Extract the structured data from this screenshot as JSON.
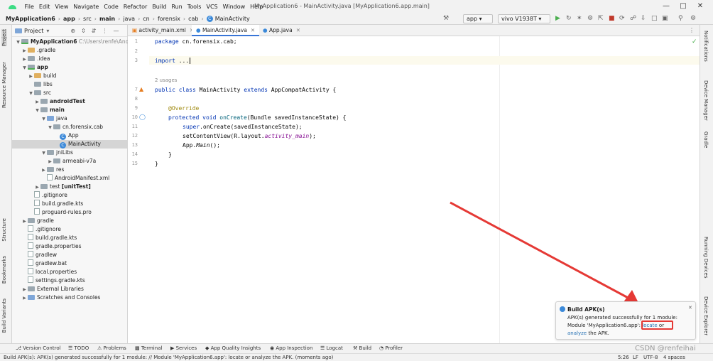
{
  "menu": [
    "File",
    "Edit",
    "View",
    "Navigate",
    "Code",
    "Refactor",
    "Build",
    "Run",
    "Tools",
    "VCS",
    "Window",
    "Help"
  ],
  "window_title": "MyApplication6 - MainActivity.java [MyApplication6.app.main]",
  "breadcrumbs": [
    "MyApplication6",
    "app",
    "src",
    "main",
    "java",
    "cn",
    "forensix",
    "cab",
    "MainActivity"
  ],
  "toolbar": {
    "run_config": "app",
    "device": "vivo V1938T"
  },
  "project_panel": {
    "header": "Project",
    "root": "MyApplication6",
    "root_path": "C:\\Users\\renfe\\Andro",
    "tree": [
      ".gradle",
      ".idea",
      "app",
      "build",
      "libs",
      "src",
      "androidTest",
      "main",
      "java",
      "cn.forensix.cab",
      "App",
      "MainActivity",
      "jniLibs",
      "armeabi-v7a",
      "res",
      "AndroidManifest.xml",
      "test",
      "[unitTest]",
      ".gitignore",
      "build.gradle.kts",
      "proguard-rules.pro",
      "gradle",
      ".gitignore",
      "build.gradle.kts",
      "gradle.properties",
      "gradlew",
      "gradlew.bat",
      "local.properties",
      "settings.gradle.kts",
      "External Libraries",
      "Scratches and Consoles"
    ]
  },
  "tabs": [
    {
      "label": "activity_main.xml"
    },
    {
      "label": "MainActivity.java"
    },
    {
      "label": "App.java"
    }
  ],
  "editor": {
    "line_numbers": [
      "1",
      "2",
      "3",
      "",
      "7",
      "8",
      "9",
      "10",
      "11",
      "12",
      "13",
      "14",
      "15"
    ],
    "usages": "2 usages",
    "code": {
      "package_kw": "package",
      "package_name": " cn.forensix.cab;",
      "import_kw": "import",
      "import_rest": " ...",
      "class_public": "public",
      "class_class": " class",
      "class_name": " MainActivity ",
      "class_extends": "extends",
      "class_rest": " AppCompatActivity {",
      "override": "@Override",
      "method_kw": "protected void",
      "method_name": " onCreate",
      "method_rest": "(Bundle savedInstanceState) {",
      "super_kw": "super",
      "super_rest": ".onCreate(savedInstanceState);",
      "setcontent_a": "setContentView(R.layout.",
      "setcontent_b": "activity_main",
      "setcontent_c": ");",
      "appmain_a": "App.",
      "appmain_b": "Main",
      "appmain_c": "();",
      "close_inner": "}",
      "close_outer": "}"
    }
  },
  "left_tool_tabs": [
    "Project",
    "Resource Manager",
    "Structure",
    "Bookmarks",
    "Build Variants"
  ],
  "right_tool_tabs": [
    "Notifications",
    "Device Manager",
    "Gradle",
    "Running Devices",
    "Device Explorer"
  ],
  "notification": {
    "title": "Build APK(s)",
    "line1": "APK(s) generated successfully for 1 module:",
    "line2_prefix": "Module 'MyApplication6.app': ",
    "locate": "locate",
    "or": " or",
    "analyze": "analyze",
    "line3_suffix": " the APK."
  },
  "bottom_tools": [
    "Version Control",
    "TODO",
    "Problems",
    "Terminal",
    "Services",
    "App Quality Insights",
    "App Inspection",
    "Logcat",
    "Build",
    "Profiler"
  ],
  "status": {
    "message": "Build APK(s): APK(s) generated successfully for 1 module: // Module 'MyApplication6.app': locate or analyze the APK. (moments ago)",
    "position": "5:26",
    "line_sep": "LF",
    "encoding": "UTF-8",
    "indent": "4 spaces",
    "watermark": "CSDN @renfeihai"
  },
  "colors": {
    "accent": "#3875d7",
    "annotation_box": "#e53935",
    "arrow": "#e53935"
  }
}
